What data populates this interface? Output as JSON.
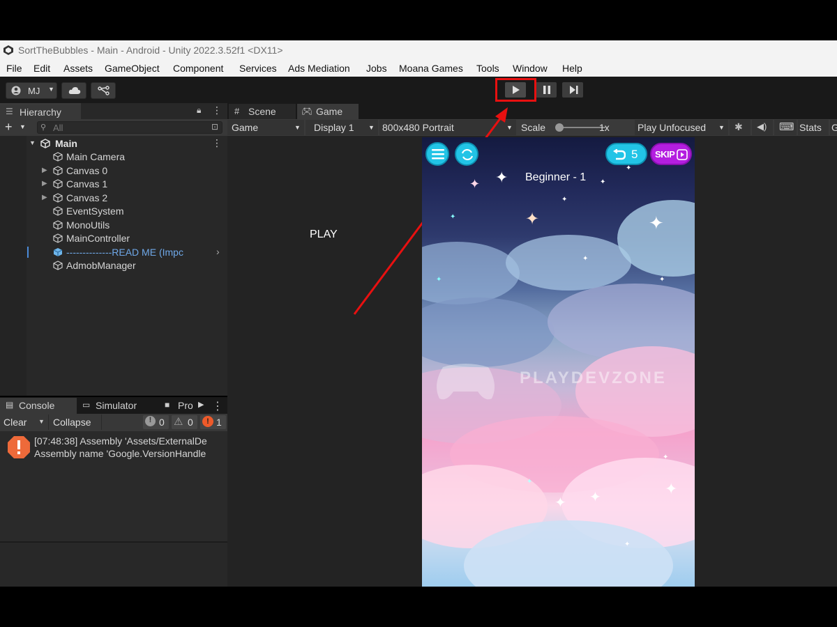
{
  "window": {
    "title": "SortTheBubbles - Main - Android - Unity 2022.3.52f1 <DX11>"
  },
  "menu": [
    "File",
    "Edit",
    "Assets",
    "GameObject",
    "Component",
    "Services",
    "Ads Mediation",
    "Jobs",
    "Moana Games",
    "Tools",
    "Window",
    "Help"
  ],
  "toolbar": {
    "account_label": "MJ"
  },
  "hierarchy": {
    "tab_label": "Hierarchy",
    "search_placeholder": "All",
    "scene_name": "Main",
    "items": [
      "Main Camera",
      "Canvas 0",
      "Canvas 1",
      "Canvas 2",
      "EventSystem",
      "MonoUtils",
      "MainController",
      "--------------READ ME (Impc",
      "AdmobManager"
    ]
  },
  "console": {
    "tabs": [
      "Console",
      "Simulator",
      "Pro"
    ],
    "clear_label": "Clear",
    "collapse_label": "Collapse",
    "info_count": "0",
    "warning_count": "0",
    "error_count": "1",
    "message_line1": "[07:48:38] Assembly 'Assets/ExternalDe",
    "message_line2": "Assembly name 'Google.VersionHandle"
  },
  "view_tabs": {
    "scene": "Scene",
    "game": "Game"
  },
  "game_toolbar": {
    "mode": "Game",
    "display": "Display 1",
    "resolution": "800x480 Portrait",
    "scale_label": "Scale",
    "scale_value": "1x",
    "play_focus": "Play Unfocused",
    "stats": "Stats",
    "extra": "G"
  },
  "annotation": {
    "label": "PLAY",
    "color": "#e81010"
  },
  "game": {
    "level_text": "Beginner - 1",
    "undo_count": "5",
    "skip_label": "SKIP",
    "watermark": "PLAYDEVZONE",
    "button_color": "#22c4e6",
    "skip_color": "#b41ee0"
  }
}
